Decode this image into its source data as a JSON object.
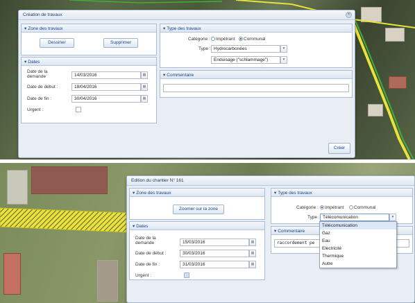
{
  "create_dialog": {
    "title": "Création de travaux",
    "zone_panel": {
      "title": "Zone des travaux",
      "draw_button": "Dessiner",
      "delete_button": "Supprimer"
    },
    "dates_panel": {
      "title": "Dates",
      "request_date_label": "Date de la demande",
      "request_date": "14/03/2016",
      "start_date_label": "Date de début :",
      "start_date": "18/04/2016",
      "end_date_label": "Date de fin :",
      "end_date": "30/04/2016",
      "urgent_label": "Urgent :"
    },
    "type_panel": {
      "title": "Type des travaux",
      "category_label": "Catégorie :",
      "category_opt1": "Impétrant",
      "category_opt2": "Communal",
      "type_label": "Type :",
      "type_value": "Hydrocarbonées",
      "subtype_value": "Enduisage (\"schlammage\")"
    },
    "comment_panel": {
      "title": "Commentaire",
      "value": ""
    },
    "create_button": "Créer"
  },
  "edit_dialog": {
    "title": "Edition du chantier N° 161",
    "zone_panel": {
      "title": "Zone des travaux",
      "zoom_button": "Zoomer sur la zone"
    },
    "dates_panel": {
      "title": "Dates",
      "request_date_label": "Date de la demande",
      "request_date": "15/03/2016",
      "start_date_label": "Date de début :",
      "start_date": "30/03/2016",
      "end_date_label": "Date de fin :",
      "end_date": "31/03/2016",
      "urgent_label": "Urgent :",
      "urgent_checked": true
    },
    "type_panel": {
      "title": "Type des travaux",
      "category_label": "Catégorie :",
      "category_opt1": "Impétrant",
      "category_opt2": "Communal",
      "type_label": "Type :",
      "type_value": "Télécomunication"
    },
    "comment_panel": {
      "title": "Commentaire",
      "value": "raccordement pe"
    },
    "type_dropdown": {
      "options": [
        "Télécomunication",
        "Gaz",
        "Eau",
        "Electricité",
        "Thermique",
        "Autre"
      ]
    }
  },
  "colors": {
    "accent": "#15428b",
    "panel_border": "#a9bdd6",
    "map_line_yellow": "#e8e23a",
    "map_line_green": "#3fae3a"
  }
}
